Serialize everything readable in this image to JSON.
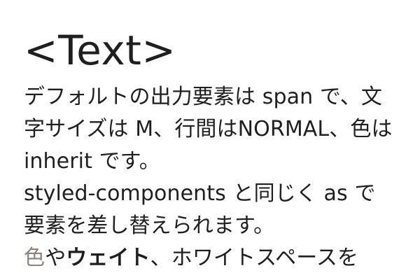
{
  "heading": {
    "title": "<Text>"
  },
  "paragraphs": [
    {
      "text": "デフォルトの出力要素は span で、文字サイズは M、行間はNORMAL、色は inherit です。"
    },
    {
      "text": "styled-components と同じく as で要素を差し替えられます。"
    },
    {
      "segments": [
        {
          "text": "色",
          "style": "muted"
        },
        {
          "text": "や",
          "style": "normal"
        },
        {
          "text": "ウェイト",
          "style": "bold"
        },
        {
          "text": "、ホワイトスペースを",
          "style": "normal"
        }
      ]
    }
  ],
  "colors": {
    "text_primary": "#1f1f1f",
    "text_muted": "#8a847d",
    "background": "#ffffff"
  }
}
